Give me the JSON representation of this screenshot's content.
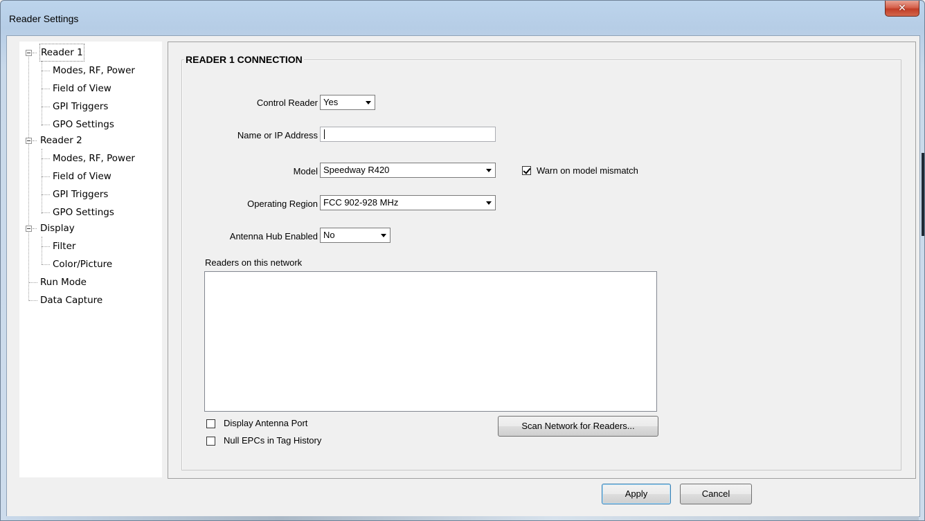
{
  "window": {
    "title": "Reader Settings",
    "close_glyph": "✕"
  },
  "tree": {
    "items": [
      {
        "label": "Reader 1",
        "level": 0,
        "expanded": true
      },
      {
        "label": "Modes, RF, Power",
        "level": 1
      },
      {
        "label": "Field of View",
        "level": 1
      },
      {
        "label": "GPI Triggers",
        "level": 1
      },
      {
        "label": "GPO Settings",
        "level": 1
      },
      {
        "label": "Reader 2",
        "level": 0,
        "expanded": true
      },
      {
        "label": "Modes, RF, Power",
        "level": 1
      },
      {
        "label": "Field of View",
        "level": 1
      },
      {
        "label": "GPI Triggers",
        "level": 1
      },
      {
        "label": "GPO Settings",
        "level": 1
      },
      {
        "label": "Display",
        "level": 0,
        "expanded": true
      },
      {
        "label": "Filter",
        "level": 1
      },
      {
        "label": "Color/Picture",
        "level": 1
      },
      {
        "label": "Run Mode",
        "level": 0
      },
      {
        "label": "Data Capture",
        "level": 0
      }
    ],
    "selected": "Reader 1"
  },
  "connection": {
    "group_title": "READER 1 CONNECTION",
    "control_reader": {
      "label": "Control Reader",
      "value": "Yes"
    },
    "name_or_ip": {
      "label": "Name or IP Address",
      "value": ""
    },
    "model": {
      "label": "Model",
      "value": "Speedway R420"
    },
    "warn_mismatch": {
      "label": "Warn on model mismatch",
      "checked": true
    },
    "operating_region": {
      "label": "Operating Region",
      "value": "FCC 902-928 MHz"
    },
    "antenna_hub": {
      "label": "Antenna Hub Enabled",
      "value": "No"
    },
    "readers_list": {
      "label": "Readers on this network",
      "items": []
    },
    "display_antenna_port": {
      "label": "Display Antenna Port",
      "checked": false
    },
    "null_epcs": {
      "label": "Null EPCs in Tag History",
      "checked": false
    },
    "scan_button": "Scan Network for Readers..."
  },
  "footer": {
    "apply_label": "Apply",
    "cancel_label": "Cancel"
  },
  "colors": {
    "titlebar": "#b6cde6",
    "close_button": "#c13d27",
    "default_button_border": "#3c7fb1"
  }
}
